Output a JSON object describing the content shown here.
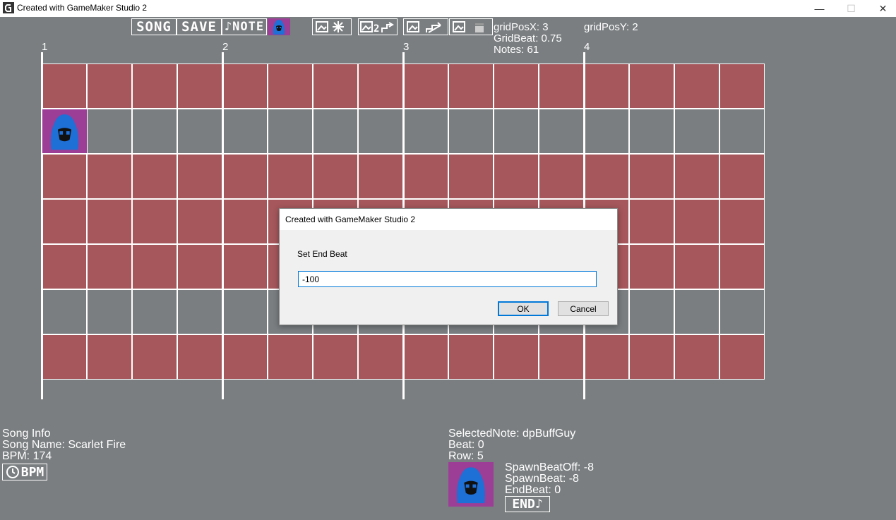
{
  "window": {
    "title": "Created with GameMaker Studio 2",
    "controls": {
      "minimize": "—",
      "maximize": "☐",
      "close": "✕"
    }
  },
  "toolbar": {
    "song_label": "SONG",
    "save_label": "SAVE",
    "note_label": "♪NOTE",
    "icons": [
      "image-icon",
      "sparkle-icon",
      "image-icon",
      "stairs-icon",
      "image-icon",
      "stairs-icon",
      "image-icon",
      "drum-icon"
    ],
    "icon_text_2": "2"
  },
  "hud": {
    "grid_pos_x": "gridPosX: 3",
    "grid_pos_y": "gridPosY: 2",
    "grid_beat": "GridBeat: 0.75",
    "notes": "Notes: 61"
  },
  "beats": [
    "1",
    "2",
    "3",
    "4"
  ],
  "grid": {
    "columns": 16,
    "row_colors": [
      "red",
      "gray",
      "red",
      "red",
      "red",
      "gray",
      "red"
    ],
    "note_cell": {
      "row": 1,
      "col": 0
    }
  },
  "song_info": {
    "heading": "Song Info",
    "name": "Song Name: Scarlet Fire",
    "bpm": "BPM: 174",
    "bpm_button_label": "BPM"
  },
  "selected_note": {
    "label": "SelectedNote: dpBuffGuy",
    "beat": "Beat: 0",
    "row": "Row: 5",
    "spawn_beat_off": "SpawnBeatOff: -8",
    "spawn_beat": "SpawnBeat: -8",
    "end_beat": "EndBeat: 0",
    "end_button_label": "END♪"
  },
  "dialog": {
    "title": "Created with GameMaker Studio 2",
    "prompt": "Set End Beat",
    "input_value": "-100",
    "ok_label": "OK",
    "cancel_label": "Cancel"
  },
  "colors": {
    "background": "#7a7e80",
    "lane_red": "#a5575b",
    "note_purple": "#9c3e96",
    "character_blue": "#1e6fd6"
  }
}
